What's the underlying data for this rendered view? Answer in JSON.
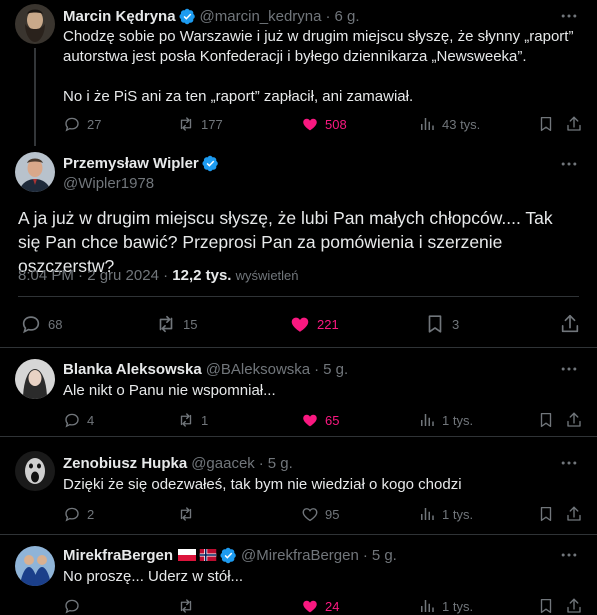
{
  "colors": {
    "background": "#000000",
    "text": "#e7e9ea",
    "muted": "#71767b",
    "like": "#f91880",
    "verified": "#1d9bf0",
    "divider": "#2f3336"
  },
  "tweets": [
    {
      "name": "Marcin Kędryna",
      "verified": true,
      "handle": "@marcin_kedryna",
      "time": "6 g.",
      "text": "Chodzę sobie po Warszawie i już w drugim miejscu słyszę, że słynny „raport” autorstwa jest posła Konfederacji i byłego dziennikarza „Newsweeka”.\n\nNo i że PiS ani za ten „raport” zapłacił, ani zamawiał.",
      "replies": "27",
      "reposts": "177",
      "likes": "508",
      "views": "43 tys.",
      "liked": true,
      "avatar_icon": "bearded-man-avatar"
    },
    {
      "name": "Przemysław Wipler",
      "verified": true,
      "handle": "@Wipler1978",
      "text": "A ja już w drugim miejscu słyszę, że lubi Pan małych chłopców.... Tak się Pan chce bawić? Przeprosi Pan za pomówienia i szerzenie oszczerstw?",
      "timestamp": "8:04 PM · 2 gru 2024",
      "views_count": "12,2 tys.",
      "views_label": "wyświetleń",
      "replies": "68",
      "reposts": "15",
      "likes": "221",
      "bookmarks": "3",
      "liked": true,
      "avatar_icon": "man-avatar"
    },
    {
      "name": "Blanka Aleksowska",
      "handle": "@BAleksowska",
      "time": "5 g.",
      "text": "Ale nikt o Panu nie wspomniał...",
      "replies": "4",
      "reposts": "1",
      "likes": "65",
      "views": "1 tys.",
      "liked": true,
      "avatar_icon": "woman-avatar"
    },
    {
      "name": "Zenobiusz Hupka",
      "handle": "@gaacek",
      "time": "5 g.",
      "text": "Dzięki że się odezwałeś, tak bym nie wiedział o kogo chodzi",
      "replies": "2",
      "reposts": "",
      "likes": "95",
      "views": "1 tys.",
      "liked": false,
      "avatar_icon": "screaming-face-avatar"
    },
    {
      "name": "MirekfraBergen",
      "flags": [
        "polish-flag-icon",
        "norwegian-flag-icon"
      ],
      "verified": true,
      "handle": "@MirekfraBergen",
      "time": "5 g.",
      "text": "No proszę... Uderz w stół...",
      "replies": "",
      "reposts": "",
      "likes": "24",
      "views": "1 tys.",
      "liked": true,
      "avatar_icon": "two-people-avatar"
    }
  ],
  "separator": "·"
}
